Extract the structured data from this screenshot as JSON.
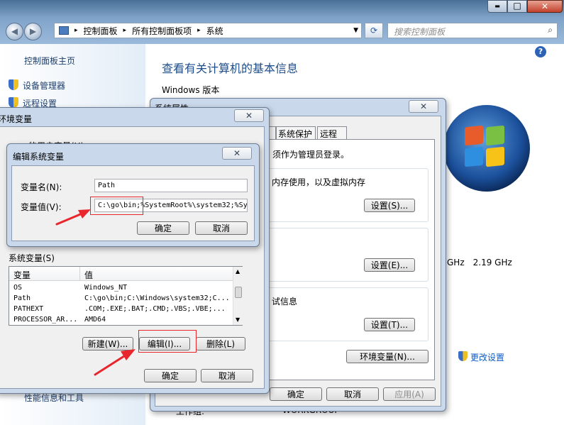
{
  "titlebar": {
    "minimize": "▬",
    "maximize": "□",
    "close": "✕"
  },
  "address": {
    "root_icon": "control-panel-icon",
    "crumbs": [
      "控制面板",
      "所有控制面板项",
      "系统"
    ],
    "sep": "▸",
    "search_placeholder": "搜索控制面板"
  },
  "sidebar": {
    "home": "控制面板主页",
    "items": [
      "设备管理器",
      "远程设置"
    ],
    "bottom": "性能信息和工具"
  },
  "main": {
    "title": "查看有关计算机的基本信息",
    "windows_edition": "Windows 版本",
    "ghz": "GHz",
    "ghz2": "2.19 GHz",
    "change_settings": "更改设置",
    "workgroup_label": "工作组:",
    "workgroup": "WORKGROUP"
  },
  "sysprops": {
    "title": "系统属性",
    "tabs": [
      "系统保护",
      "远程"
    ],
    "admin_note": "须作为管理员登录。",
    "perf_text": "内存使用，以及虚拟内存",
    "settings1": "设置(S)...",
    "settings2": "设置(E)...",
    "debug_text": "试信息",
    "settings3": "设置(T)...",
    "env_button": "环境变量(N)...",
    "ok": "确定",
    "cancel": "取消",
    "apply": "应用(A)"
  },
  "envvars": {
    "title": "环境变量",
    "user_vars": "的用户变量(U)",
    "sys_vars_label": "系统变量(S)",
    "col_var": "变量",
    "col_val": "值",
    "rows": [
      {
        "name": "OS",
        "value": "Windows_NT"
      },
      {
        "name": "Path",
        "value": "C:\\go\\bin;C:\\Windows\\system32;C..."
      },
      {
        "name": "PATHEXT",
        "value": ".COM;.EXE;.BAT;.CMD;.VBS;.VBE;..."
      },
      {
        "name": "PROCESSOR_AR...",
        "value": "AMD64"
      }
    ],
    "new": "新建(W)...",
    "edit": "编辑(I)...",
    "delete": "删除(L)",
    "ok": "确定",
    "cancel": "取消"
  },
  "editvar": {
    "title": "编辑系统变量",
    "name_label": "变量名(N):",
    "name_value": "Path",
    "value_label": "变量值(V):",
    "value_value": "C:\\go\\bin;%SystemRoot%\\system32;%Sys",
    "ok": "确定",
    "cancel": "取消"
  },
  "colors": {
    "annotation": "#e8262c",
    "link": "#0b5bc5",
    "title_blue": "#1e4e8c"
  }
}
